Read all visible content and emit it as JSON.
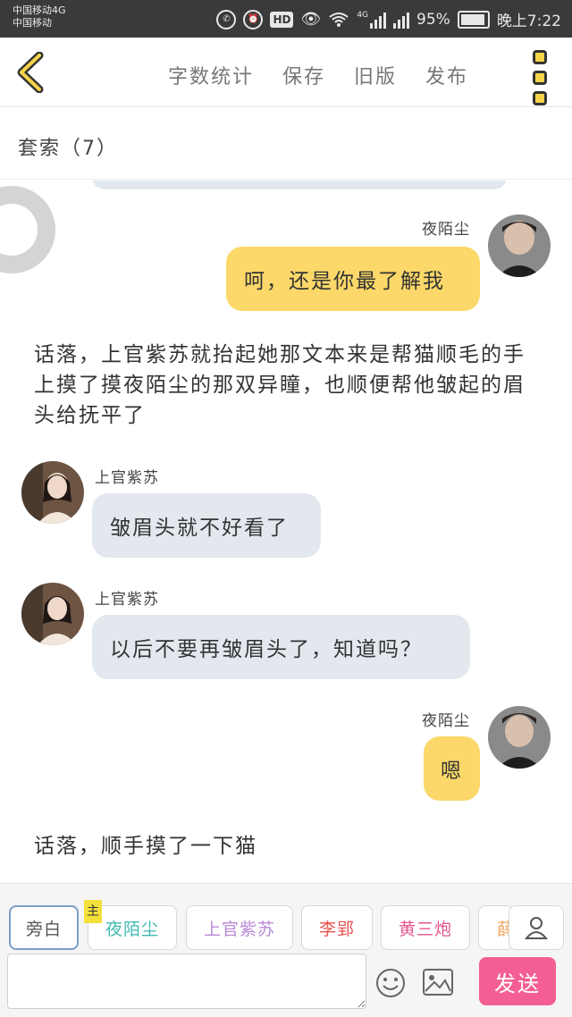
{
  "status_bar": {
    "carrier_line1": "中国移动4G",
    "carrier_line2": "中国移动",
    "network": "4G",
    "battery": "95%",
    "time": "晚上7:22"
  },
  "toolbar": {
    "word_count": "字数统计",
    "save": "保存",
    "old_version": "旧版",
    "publish": "发布"
  },
  "chapter": {
    "title": "套索（7）"
  },
  "messages": [
    {
      "type": "right",
      "name": "夜陌尘",
      "text": "呵，还是你最了解我"
    },
    {
      "type": "narration",
      "text": "话落，上官紫苏就抬起她那文本来是帮猫顺毛的手上摸了摸夜陌尘的那双异瞳，也顺便帮他皱起的眉头给抚平了"
    },
    {
      "type": "left",
      "name": "上官紫苏",
      "text": "皱眉头就不好看了"
    },
    {
      "type": "left",
      "name": "上官紫苏",
      "text": "以后不要再皱眉头了，知道吗？"
    },
    {
      "type": "right",
      "name": "夜陌尘",
      "text": "嗯"
    },
    {
      "type": "narration",
      "text": "话落，顺手摸了一下猫"
    }
  ],
  "characters": [
    {
      "label": "旁白",
      "color": "#555555"
    },
    {
      "label": "夜陌尘",
      "color": "#3fb9b0",
      "tag": "主"
    },
    {
      "label": "上官紫苏",
      "color": "#b98ad8"
    },
    {
      "label": "李郢",
      "color": "#e8524f"
    },
    {
      "label": "黄三炮",
      "color": "#e4558f"
    },
    {
      "label": "薛",
      "color": "#f2a65a"
    }
  ],
  "composer": {
    "input_value": "",
    "send": "发送"
  },
  "colors": {
    "accent_yellow": "#fbd869",
    "left_bubble": "#e3e8ef",
    "send_pink": "#f35f94"
  }
}
